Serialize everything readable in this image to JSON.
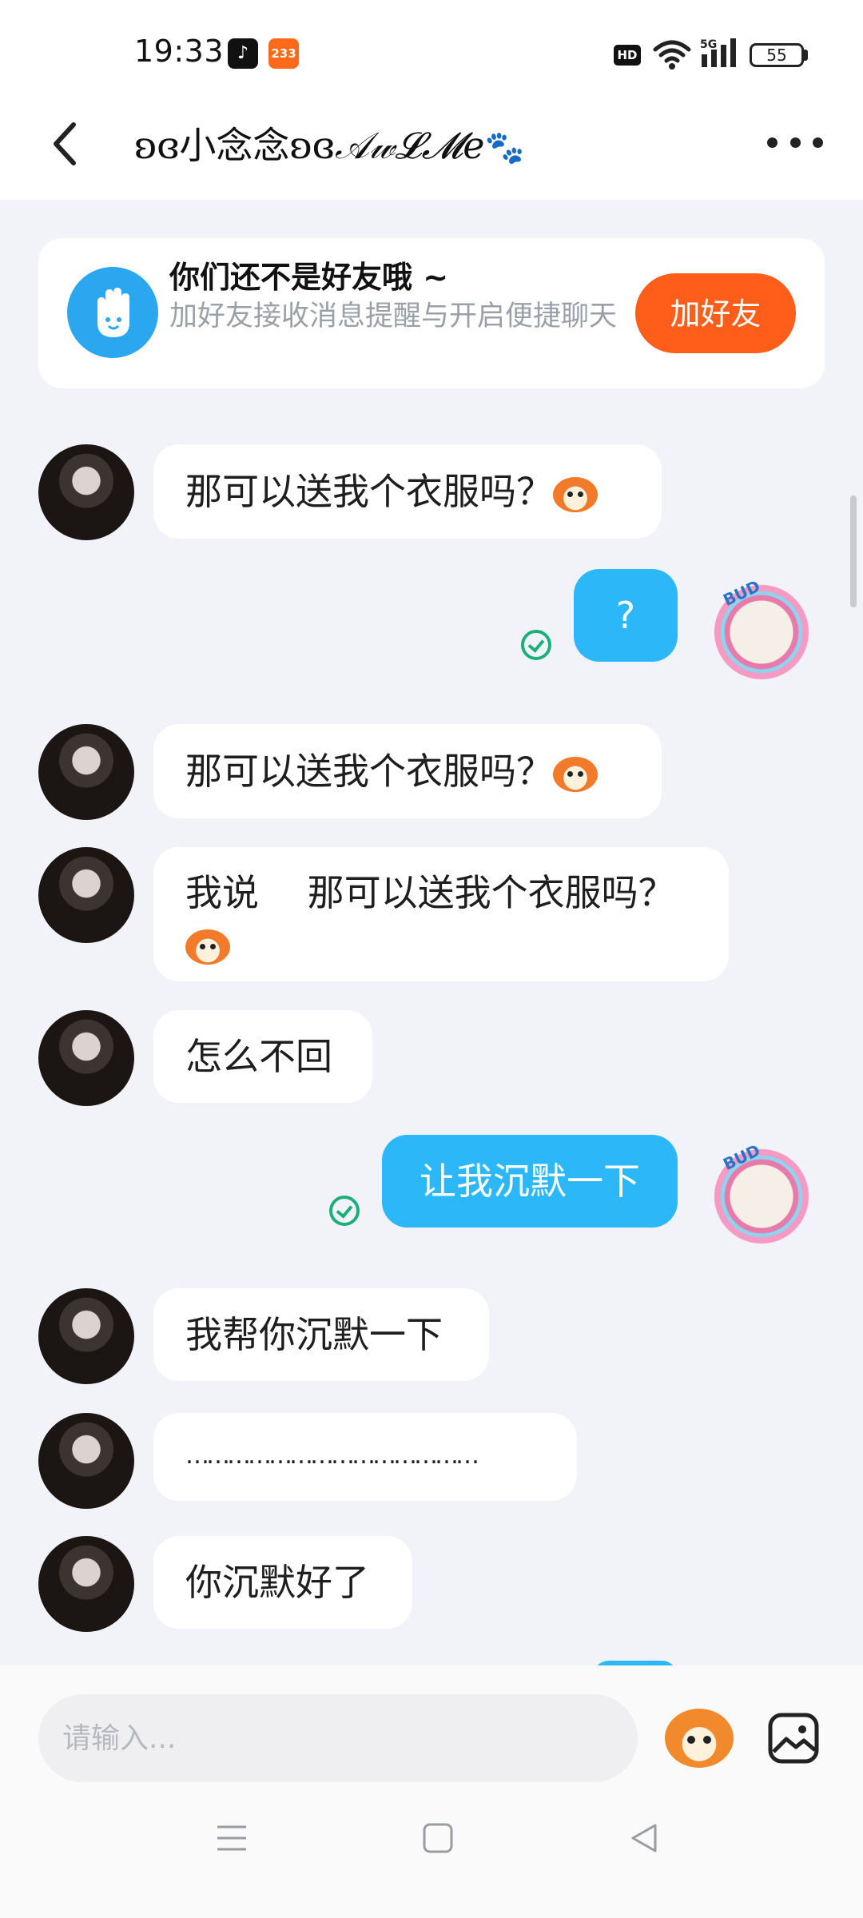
{
  "status_bar": {
    "time": "19:33",
    "app_badge_233": "233",
    "hd": "HD",
    "network": "5G",
    "battery": "55"
  },
  "header": {
    "title_prefix": "ʚɞ小念念ʚɞ",
    "title_suffix": "𝒜𝓌𝓛𝓜𝑒",
    "title_paw": "🐾",
    "icons": [
      "back-arrow-icon",
      "more-dots-icon"
    ]
  },
  "friend_banner": {
    "title": "你们还不是好友哦 ~",
    "description": "加好友接收消息提醒与开启便捷聊天",
    "button": "加好友"
  },
  "messages": [
    {
      "side": "left",
      "text": "那可以送我个衣服吗？",
      "emoji": true
    },
    {
      "side": "right",
      "text": "?",
      "status": "sent"
    },
    {
      "side": "left",
      "text": "那可以送我个衣服吗？",
      "emoji": true
    },
    {
      "side": "left",
      "text": "我说　 那可以送我个衣服吗？",
      "emoji": true
    },
    {
      "side": "left",
      "text": "怎么不回"
    },
    {
      "side": "right",
      "text": "让我沉默一下",
      "status": "sent"
    },
    {
      "side": "left",
      "text": "我帮你沉默一下"
    },
    {
      "side": "left",
      "text": "……………………………………"
    },
    {
      "side": "left",
      "text": "你沉默好了"
    }
  ],
  "composer": {
    "placeholder": "请输入..."
  },
  "colors": {
    "accent_blue": "#2cb7f9",
    "add_friend_orange": "#ff5e1a",
    "sent_check_green": "#1bb07a",
    "background": "#f2f3f8"
  }
}
